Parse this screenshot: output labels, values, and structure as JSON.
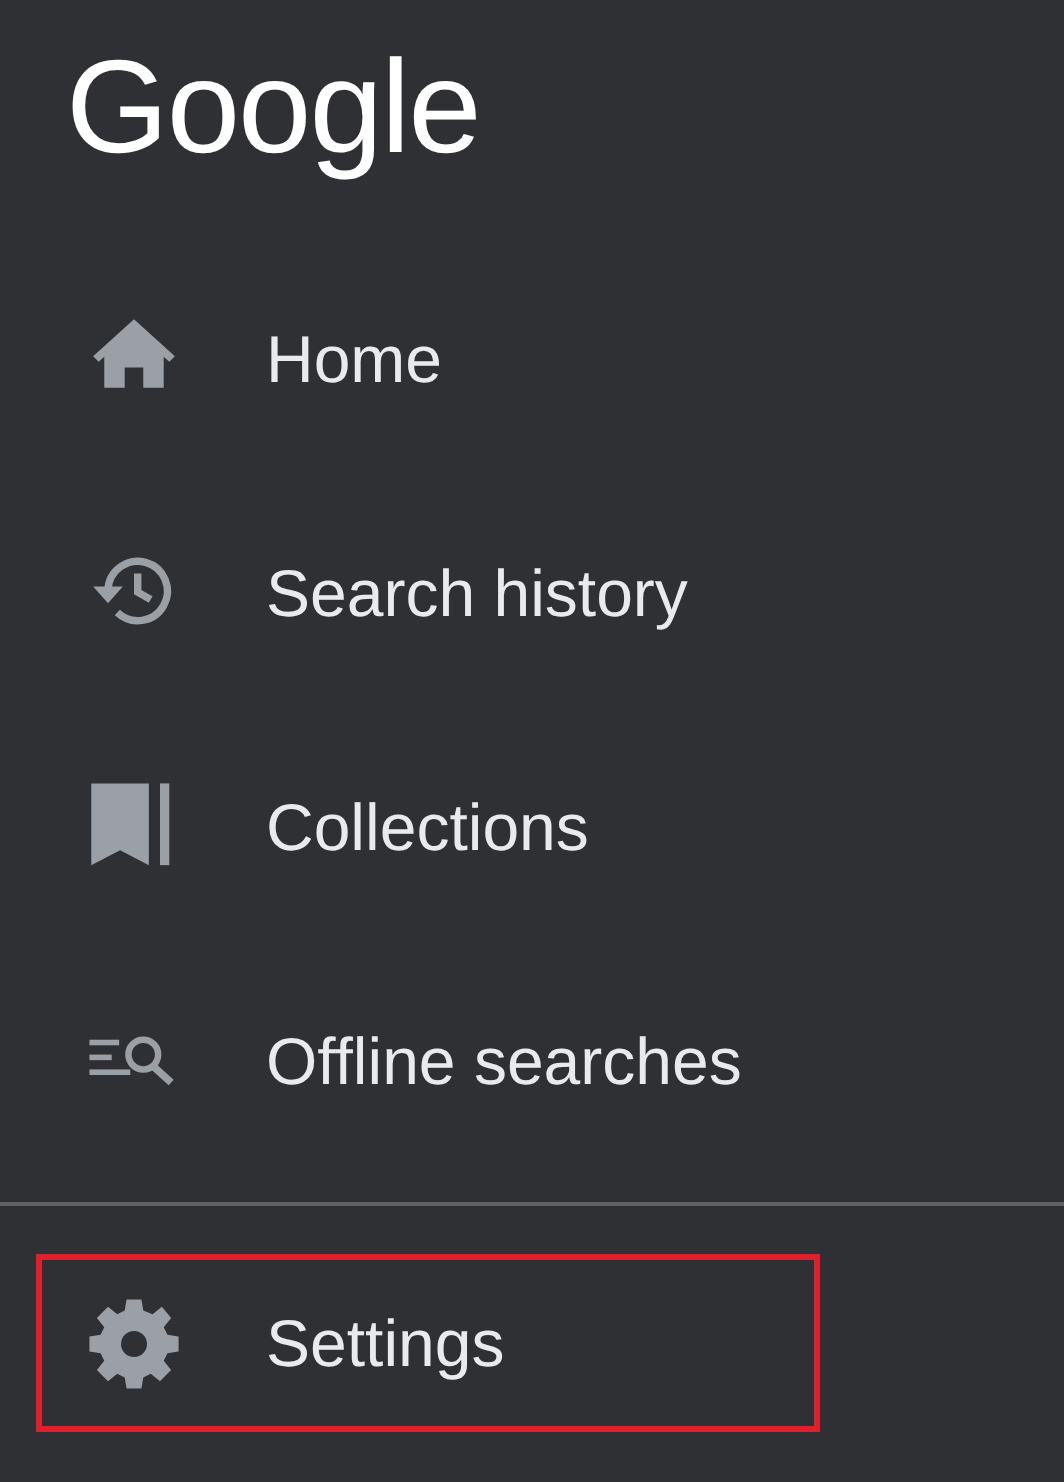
{
  "logo": "Google",
  "menu": [
    {
      "kind": "home",
      "label": "Home",
      "highlighted": false
    },
    {
      "kind": "history",
      "label": "Search history",
      "highlighted": false
    },
    {
      "kind": "collections",
      "label": "Collections",
      "highlighted": false
    },
    {
      "kind": "offline",
      "label": "Offline searches",
      "highlighted": false
    }
  ],
  "footer_menu": [
    {
      "kind": "settings",
      "label": "Settings",
      "highlighted": true
    }
  ]
}
